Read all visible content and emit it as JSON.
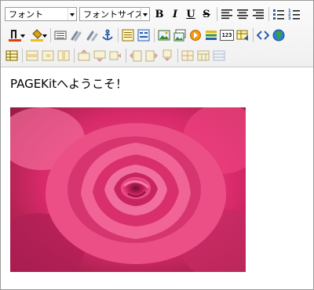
{
  "toolbar": {
    "font_select": "フォント",
    "font_size_select": "フォントサイズ",
    "bold_label": "B",
    "italic_label": "I",
    "underline_label": "U",
    "strike_label": "S",
    "insert_text_label": "123"
  },
  "content": {
    "welcome": "PAGEKitへようこそ！",
    "image": "pink-rose-photo"
  },
  "colors": {
    "toolbar_bg": "#f0f0f0",
    "accent_blue": "#2b5ea8",
    "rose": "#e0407a"
  }
}
